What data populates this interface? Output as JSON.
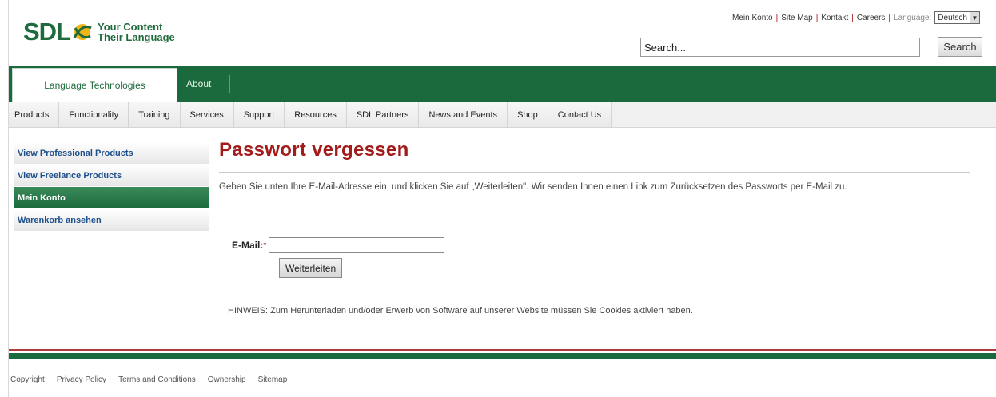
{
  "brand": {
    "logo_text": "SDL",
    "tagline_line1": "Your Content",
    "tagline_line2": "Their Language",
    "green": "#1b6a3d",
    "red": "#a31c1c"
  },
  "top_links": [
    "Mein Konto",
    "Site Map",
    "Kontakt",
    "Careers"
  ],
  "language": {
    "label": "Language:",
    "selected": "Deutsch"
  },
  "search": {
    "placeholder": "Search...",
    "value": "Search...",
    "button": "Search"
  },
  "main_tabs": [
    {
      "label": "Language Technologies",
      "active": true
    },
    {
      "label": "About",
      "active": false
    }
  ],
  "sub_nav": [
    "Products",
    "Functionality",
    "Training",
    "Services",
    "Support",
    "Resources",
    "SDL Partners",
    "News and Events",
    "Shop",
    "Contact Us"
  ],
  "sidebar": [
    {
      "label": "View Professional Products",
      "active": false
    },
    {
      "label": "View Freelance Products",
      "active": false
    },
    {
      "label": "Mein Konto",
      "active": true
    },
    {
      "label": "Warenkorb ansehen",
      "active": false
    }
  ],
  "content": {
    "title": "Passwort vergessen",
    "intro": "Geben Sie unten Ihre E-Mail-Adresse ein, und klicken Sie auf „Weiterleiten\". Wir senden Ihnen einen Link zum Zurücksetzen des Passworts per E-Mail zu.",
    "email_label": "E-Mail:",
    "required_marker": "*",
    "email_value": "",
    "submit_button": "Weiterleiten",
    "note": "HINWEIS: Zum Herunterladen und/oder Erwerb von Software auf unserer Website müssen Sie Cookies aktiviert haben."
  },
  "footer": [
    "Copyright",
    "Privacy Policy",
    "Terms and Conditions",
    "Ownership",
    "Sitemap"
  ]
}
